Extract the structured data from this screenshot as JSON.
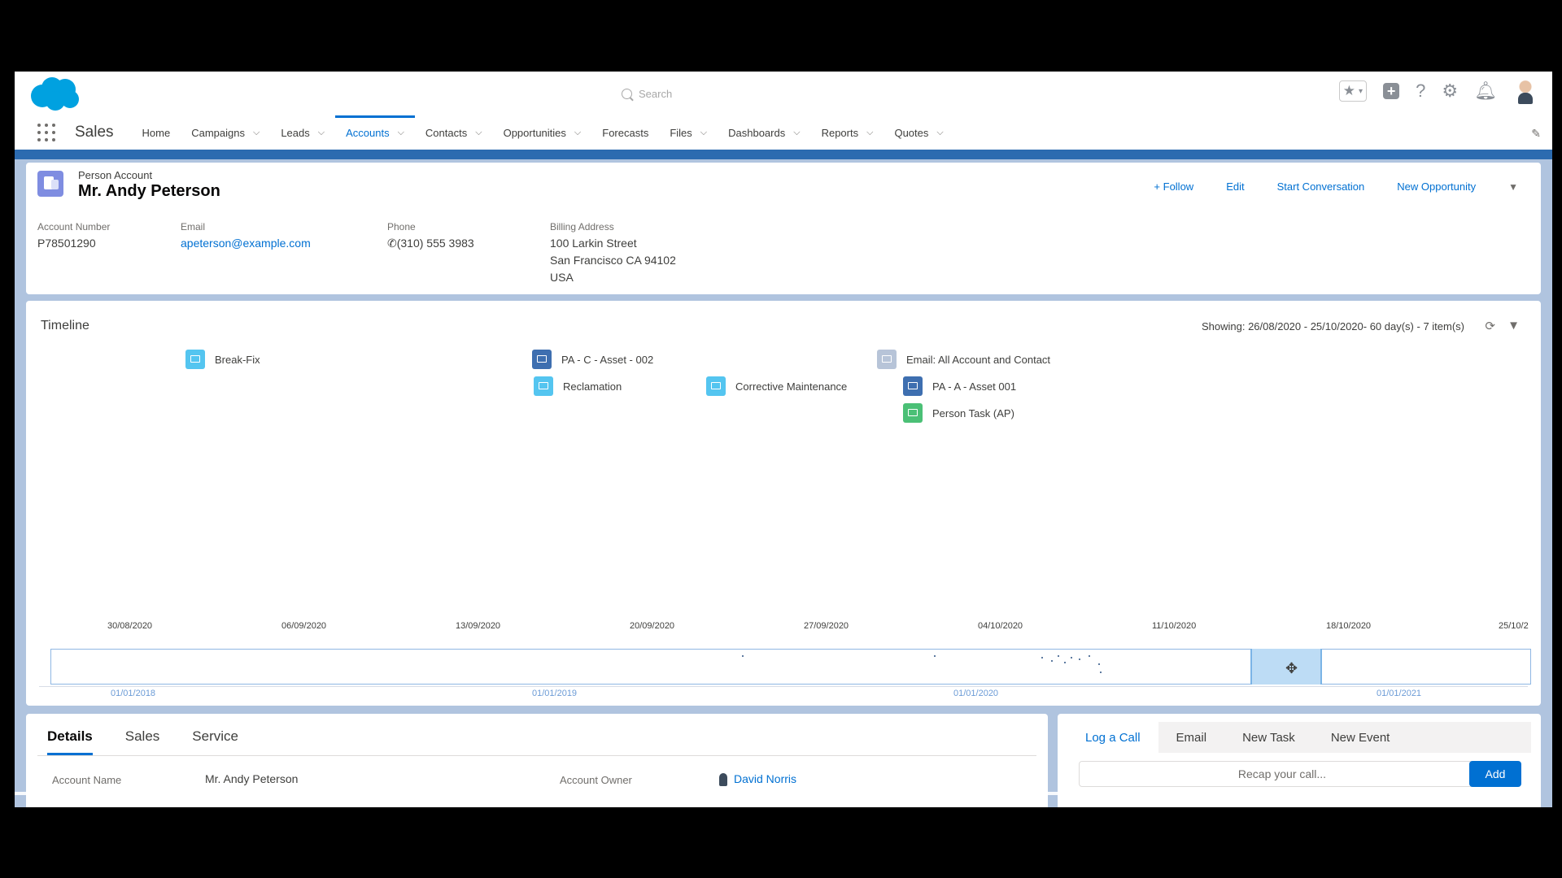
{
  "header": {
    "search_placeholder": "Search",
    "app_name": "Sales",
    "brand_color": "#00a1e0",
    "accent_color": "#0070d2"
  },
  "nav": {
    "items": [
      {
        "label": "Home",
        "chevron": false
      },
      {
        "label": "Campaigns",
        "chevron": true
      },
      {
        "label": "Leads",
        "chevron": true
      },
      {
        "label": "Accounts",
        "chevron": true,
        "active": true
      },
      {
        "label": "Contacts",
        "chevron": true
      },
      {
        "label": "Opportunities",
        "chevron": true
      },
      {
        "label": "Forecasts",
        "chevron": false
      },
      {
        "label": "Files",
        "chevron": true
      },
      {
        "label": "Dashboards",
        "chevron": true
      },
      {
        "label": "Reports",
        "chevron": true
      },
      {
        "label": "Quotes",
        "chevron": true
      }
    ]
  },
  "record": {
    "object_type": "Person Account",
    "title": "Mr. Andy Peterson",
    "actions": {
      "follow": "+ Follow",
      "edit": "Edit",
      "start_conversation": "Start Conversation",
      "new_opportunity": "New Opportunity"
    },
    "fields": {
      "account_number_label": "Account Number",
      "account_number": "P78501290",
      "email_label": "Email",
      "email": "apeterson@example.com",
      "phone_label": "Phone",
      "phone": "(310) 555 3983",
      "billing_label": "Billing Address",
      "billing_line1": "100 Larkin Street",
      "billing_line2": "San Francisco CA 94102",
      "billing_line3": "USA"
    }
  },
  "timeline": {
    "title": "Timeline",
    "showing": "Showing: 26/08/2020 - 25/10/2020- 60 day(s) - 7 item(s)",
    "events": [
      {
        "label": "Break-Fix",
        "color": "#54c5f0"
      },
      {
        "label": "PA - C - Asset - 002",
        "color": "#3e6fb0"
      },
      {
        "label": "Reclamation",
        "color": "#54c5f0"
      },
      {
        "label": "Corrective Maintenance",
        "color": "#54c5f0"
      },
      {
        "label": "Email: All Account and Contact",
        "color": "#b7c4d8"
      },
      {
        "label": "PA - A - Asset 001",
        "color": "#3e6fb0"
      },
      {
        "label": "Person Task (AP)",
        "color": "#4bc076"
      }
    ],
    "dates": [
      "30/08/2020",
      "06/09/2020",
      "13/09/2020",
      "20/09/2020",
      "27/09/2020",
      "04/10/2020",
      "11/10/2020",
      "18/10/2020",
      "25/10/2"
    ],
    "years": [
      "01/01/2018",
      "01/01/2019",
      "01/01/2020",
      "01/01/2021"
    ]
  },
  "details": {
    "tabs": [
      "Details",
      "Sales",
      "Service"
    ],
    "account_name_label": "Account Name",
    "account_name": "Mr. Andy Peterson",
    "account_owner_label": "Account Owner",
    "account_owner": "David Norris"
  },
  "activity": {
    "tabs": [
      "Log a Call",
      "Email",
      "New Task",
      "New Event"
    ],
    "recap_placeholder": "Recap your call...",
    "add_label": "Add"
  }
}
